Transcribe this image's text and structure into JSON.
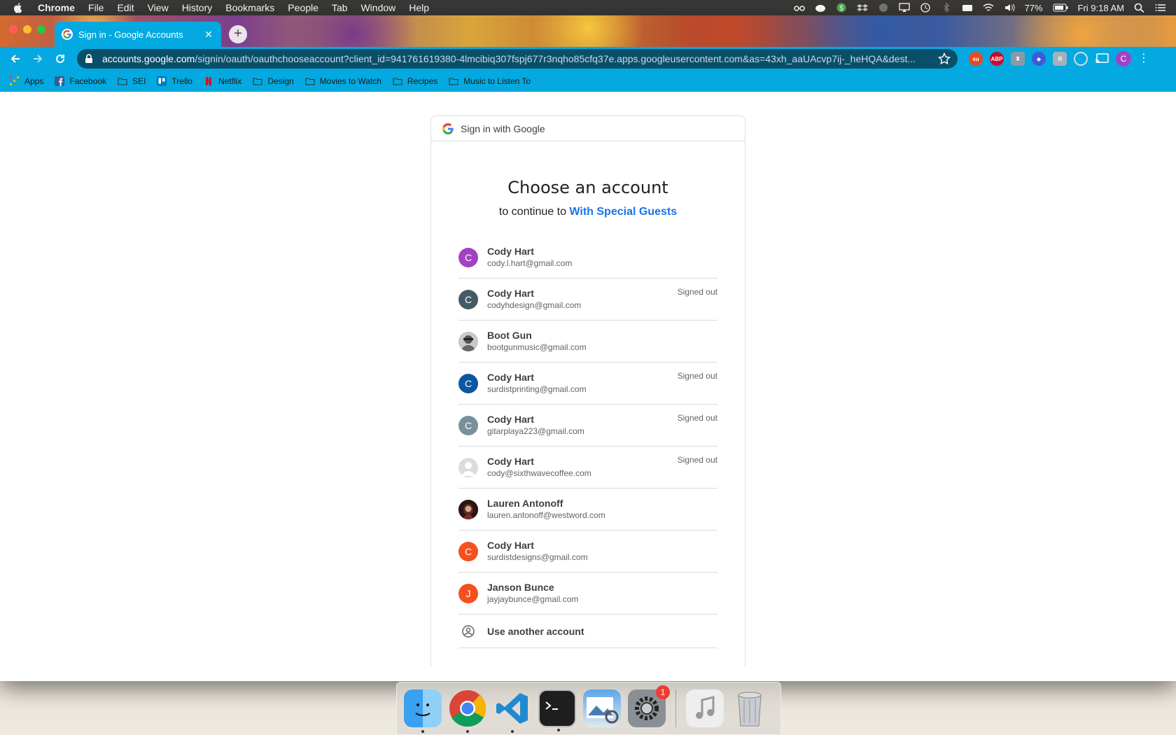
{
  "menubar": {
    "app": "Chrome",
    "items": [
      "File",
      "Edit",
      "View",
      "History",
      "Bookmarks",
      "People",
      "Tab",
      "Window",
      "Help"
    ],
    "battery": "77%",
    "clock": "Fri 9:18 AM"
  },
  "browser": {
    "tab_title": "Sign in - Google Accounts",
    "url_host": "accounts.google.com",
    "url_path": "/signin/oauth/oauthchooseaccount?client_id=941761619380-4lmcibiq307fspj677r3nqho85cfq37e.apps.googleusercontent.com&as=43xh_aaUAcvp7ij-_heHQA&dest...",
    "profile_initial": "C",
    "extensions": [
      "ABP"
    ]
  },
  "bookmarks": [
    {
      "label": "Apps",
      "icon": "apps-grid-icon"
    },
    {
      "label": "Facebook",
      "icon": "facebook-icon"
    },
    {
      "label": "SEI",
      "icon": "folder-icon"
    },
    {
      "label": "Trello",
      "icon": "trello-icon"
    },
    {
      "label": "Netflix",
      "icon": "netflix-icon"
    },
    {
      "label": "Design",
      "icon": "folder-icon"
    },
    {
      "label": "Movies to Watch",
      "icon": "folder-icon"
    },
    {
      "label": "Recipes",
      "icon": "folder-icon"
    },
    {
      "label": "Music to Listen To",
      "icon": "folder-icon"
    }
  ],
  "signin": {
    "header": "Sign in with Google",
    "title": "Choose an account",
    "subtitle_prefix": "to continue to",
    "app_name": "With Special Guests",
    "accounts": [
      {
        "name": "Cody Hart",
        "email": "cody.l.hart@gmail.com",
        "status": "",
        "initial": "C",
        "color": "#a142c4"
      },
      {
        "name": "Cody Hart",
        "email": "codyhdesign@gmail.com",
        "status": "Signed out",
        "initial": "C",
        "color": "#455a64"
      },
      {
        "name": "Boot Gun",
        "email": "bootgunmusic@gmail.com",
        "status": "",
        "initial": "",
        "color": "#8a8a8a"
      },
      {
        "name": "Cody Hart",
        "email": "surdistprinting@gmail.com",
        "status": "Signed out",
        "initial": "C",
        "color": "#0b57a0"
      },
      {
        "name": "Cody Hart",
        "email": "gitarplaya223@gmail.com",
        "status": "Signed out",
        "initial": "C",
        "color": "#78909c"
      },
      {
        "name": "Cody Hart",
        "email": "cody@sixthwavecoffee.com",
        "status": "Signed out",
        "initial": "",
        "color": "#dadce0"
      },
      {
        "name": "Lauren Antonoff",
        "email": "lauren.antonoff@westword.com",
        "status": "",
        "initial": "",
        "color": "#3a1f1f"
      },
      {
        "name": "Cody Hart",
        "email": "surdistdesigns@gmail.com",
        "status": "",
        "initial": "C",
        "color": "#f4511e"
      },
      {
        "name": "Janson Bunce",
        "email": "jayjaybunce@gmail.com",
        "status": "",
        "initial": "J",
        "color": "#f4511e"
      }
    ],
    "use_another": "Use another account"
  },
  "dock": {
    "apps": [
      "Finder",
      "Google Chrome",
      "Visual Studio Code",
      "Terminal",
      "Preview",
      "System Preferences",
      "Music",
      "Trash"
    ],
    "system_prefs_badge": "1"
  }
}
